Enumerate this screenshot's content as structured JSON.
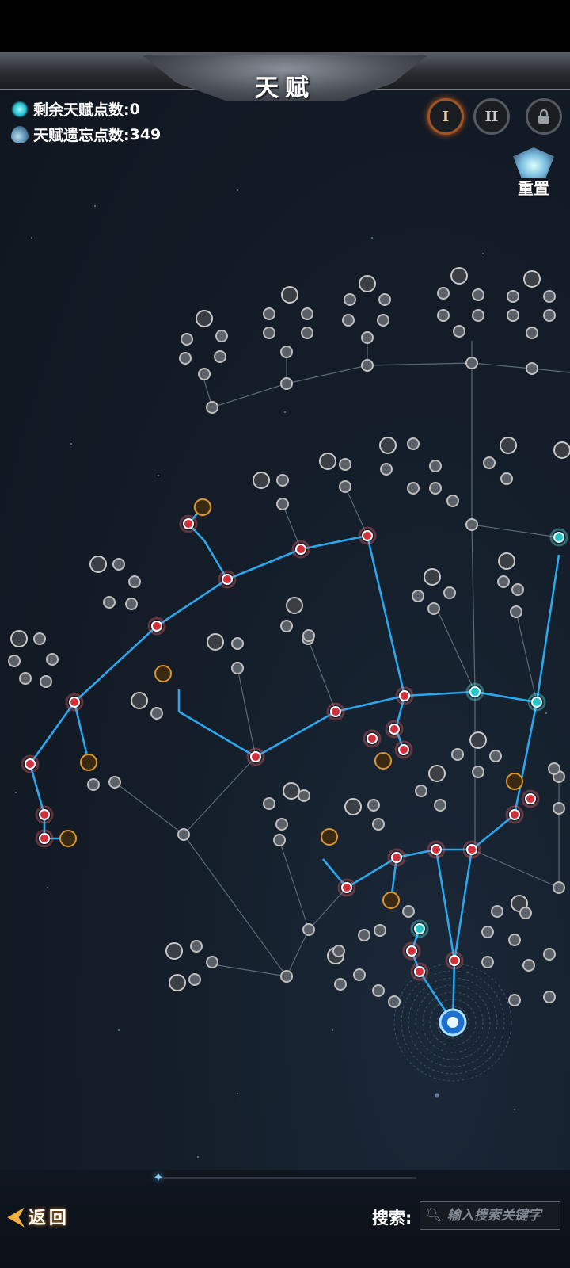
{
  "header": {
    "title": "天赋"
  },
  "stats": {
    "remaining_label": "剩余天赋点数:",
    "remaining_value": "0",
    "forget_label": "天赋遗忘点数:",
    "forget_value": "349"
  },
  "page_buttons": [
    {
      "label": "I",
      "state": "active"
    },
    {
      "label": "II",
      "state": "inactive"
    },
    {
      "icon": "lock-icon",
      "state": "locked"
    }
  ],
  "reset": {
    "label": "重置"
  },
  "footer": {
    "back_label": "返回",
    "search_label": "搜索:",
    "search_placeholder": "输入搜索关键字"
  },
  "colors": {
    "background": "#141d29",
    "path_active": "#2aa8ee",
    "node_allocated_red": "#d2303c",
    "node_allocated_cyan": "#2ac4c8",
    "node_unallocated": "#bfbfbf",
    "keystone_gold": "#d9962a",
    "back_accent": "#f0b040"
  }
}
